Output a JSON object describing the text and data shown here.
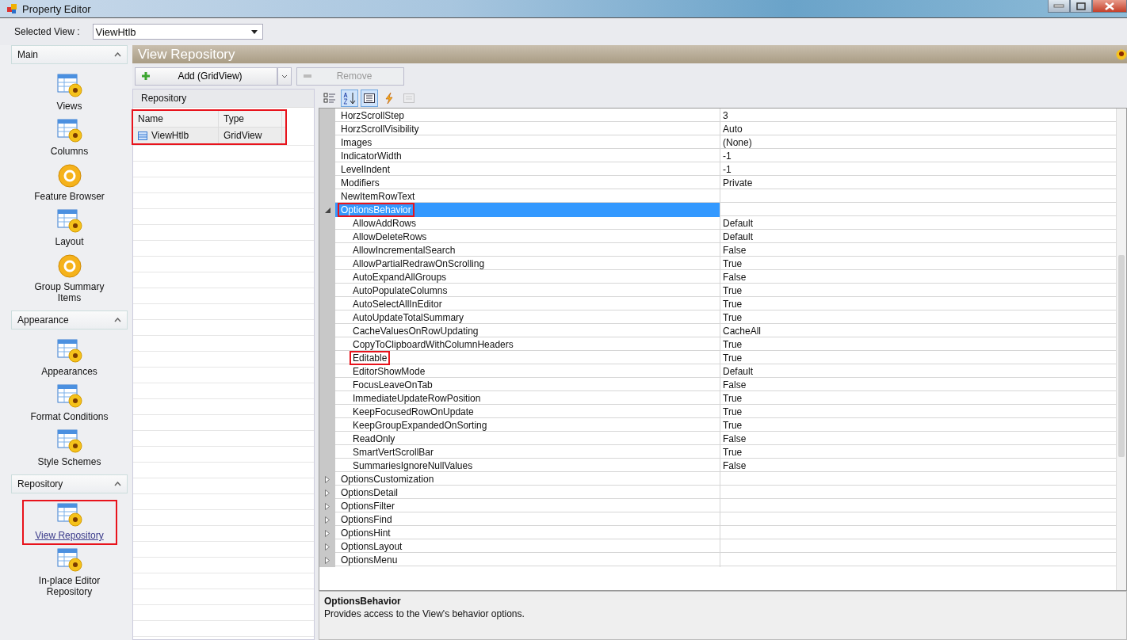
{
  "window": {
    "title": "Property Editor"
  },
  "selected_view": {
    "label": "Selected View :",
    "value": "ViewHtlb"
  },
  "sidebar": [
    {
      "title": "Main",
      "items": [
        {
          "label": "Views",
          "kind": "table",
          "selected": false,
          "highlighted": false
        },
        {
          "label": "Columns",
          "kind": "table",
          "selected": false,
          "highlighted": false
        },
        {
          "label": "Feature Browser",
          "kind": "round",
          "selected": false,
          "highlighted": false
        },
        {
          "label": "Layout",
          "kind": "table",
          "selected": false,
          "highlighted": false
        },
        {
          "label": "Group Summary Items",
          "kind": "round",
          "selected": false,
          "highlighted": false
        }
      ]
    },
    {
      "title": "Appearance",
      "items": [
        {
          "label": "Appearances",
          "kind": "table",
          "selected": false,
          "highlighted": false
        },
        {
          "label": "Format Conditions",
          "kind": "table",
          "selected": false,
          "highlighted": false
        },
        {
          "label": "Style Schemes",
          "kind": "table",
          "selected": false,
          "highlighted": false
        }
      ]
    },
    {
      "title": "Repository",
      "items": [
        {
          "label": "View Repository",
          "kind": "table",
          "selected": true,
          "highlighted": true
        },
        {
          "label": "In-place Editor Repository",
          "kind": "table",
          "selected": false,
          "highlighted": false
        }
      ]
    }
  ],
  "page_title": "View Repository",
  "buttons": {
    "add": "Add (GridView)",
    "remove": "Remove",
    "remove_disabled": true
  },
  "repository": {
    "title": "Repository",
    "highlighted": true,
    "columns": [
      "Name",
      "Type"
    ],
    "rows": [
      {
        "name": "ViewHtlb",
        "type": "GridView",
        "selected": true
      }
    ]
  },
  "properties": [
    {
      "name": "HorzScrollStep",
      "value": "3",
      "selected": false,
      "highlighted": false
    },
    {
      "name": "HorzScrollVisibility",
      "value": "Auto",
      "selected": false,
      "highlighted": false
    },
    {
      "name": "Images",
      "value": "(None)",
      "selected": false,
      "highlighted": false
    },
    {
      "name": "IndicatorWidth",
      "value": "-1",
      "selected": false,
      "highlighted": false
    },
    {
      "name": "LevelIndent",
      "value": "-1",
      "selected": false,
      "highlighted": false
    },
    {
      "name": "Modifiers",
      "value": "Private",
      "selected": false,
      "highlighted": false
    },
    {
      "name": "NewItemRowText",
      "selected": false,
      "highlighted": false
    },
    {
      "name": "OptionsBehavior",
      "selected": true,
      "highlighted": true,
      "expanded": true,
      "children": [
        {
          "name": "AllowAddRows",
          "value": "Default",
          "selected": false,
          "highlighted": false
        },
        {
          "name": "AllowDeleteRows",
          "value": "Default",
          "selected": false,
          "highlighted": false
        },
        {
          "name": "AllowIncrementalSearch",
          "value": "False",
          "selected": false,
          "highlighted": false
        },
        {
          "name": "AllowPartialRedrawOnScrolling",
          "value": "True",
          "selected": false,
          "highlighted": false
        },
        {
          "name": "AutoExpandAllGroups",
          "value": "False",
          "selected": false,
          "highlighted": false
        },
        {
          "name": "AutoPopulateColumns",
          "value": "True",
          "selected": false,
          "highlighted": false
        },
        {
          "name": "AutoSelectAllInEditor",
          "value": "True",
          "selected": false,
          "highlighted": false
        },
        {
          "name": "AutoUpdateTotalSummary",
          "value": "True",
          "selected": false,
          "highlighted": false
        },
        {
          "name": "CacheValuesOnRowUpdating",
          "value": "CacheAll",
          "selected": false,
          "highlighted": false
        },
        {
          "name": "CopyToClipboardWithColumnHeaders",
          "value": "True",
          "selected": false,
          "highlighted": false
        },
        {
          "name": "Editable",
          "value": "True",
          "selected": false,
          "highlighted": true
        },
        {
          "name": "EditorShowMode",
          "value": "Default",
          "selected": false,
          "highlighted": false
        },
        {
          "name": "FocusLeaveOnTab",
          "value": "False",
          "selected": false,
          "highlighted": false
        },
        {
          "name": "ImmediateUpdateRowPosition",
          "value": "True",
          "selected": false,
          "highlighted": false
        },
        {
          "name": "KeepFocusedRowOnUpdate",
          "value": "True",
          "selected": false,
          "highlighted": false
        },
        {
          "name": "KeepGroupExpandedOnSorting",
          "value": "True",
          "selected": false,
          "highlighted": false
        },
        {
          "name": "ReadOnly",
          "value": "False",
          "selected": false,
          "highlighted": false
        },
        {
          "name": "SmartVertScrollBar",
          "value": "True",
          "selected": false,
          "highlighted": false
        },
        {
          "name": "SummariesIgnoreNullValues",
          "value": "False",
          "selected": false,
          "highlighted": false
        }
      ]
    },
    {
      "name": "OptionsCustomization",
      "selected": false,
      "highlighted": false,
      "expanded": false
    },
    {
      "name": "OptionsDetail",
      "selected": false,
      "highlighted": false,
      "expanded": false
    },
    {
      "name": "OptionsFilter",
      "selected": false,
      "highlighted": false,
      "expanded": false
    },
    {
      "name": "OptionsFind",
      "selected": false,
      "highlighted": false,
      "expanded": false
    },
    {
      "name": "OptionsHint",
      "selected": false,
      "highlighted": false,
      "expanded": false
    },
    {
      "name": "OptionsLayout",
      "selected": false,
      "highlighted": false,
      "expanded": false
    },
    {
      "name": "OptionsMenu",
      "selected": false,
      "highlighted": false,
      "expanded": false
    }
  ],
  "description": {
    "title": "OptionsBehavior",
    "text": "Provides access to the View's behavior options."
  }
}
